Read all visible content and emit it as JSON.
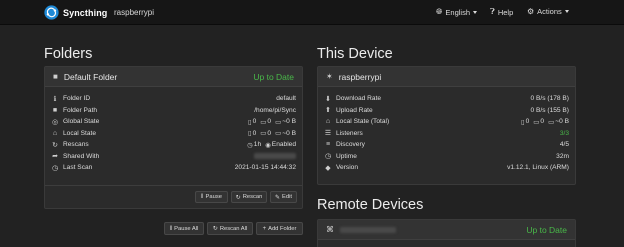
{
  "navbar": {
    "brand": "Syncthing",
    "device": "raspberrypi",
    "language": "English",
    "help": "Help",
    "actions": "Actions"
  },
  "folders": {
    "title": "Folders",
    "folder": {
      "name": "Default Folder",
      "status": "Up to Date",
      "rows": [
        {
          "icon": "info-icon",
          "label": "Folder ID",
          "value": "default"
        },
        {
          "icon": "folder-icon",
          "label": "Folder Path",
          "value": "/home/pi/Sync"
        },
        {
          "icon": "globe-icon",
          "label": "Global State",
          "files": "0",
          "dirs": "0",
          "size": "~0 B"
        },
        {
          "icon": "home-icon",
          "label": "Local State",
          "files": "0",
          "dirs": "0",
          "size": "~0 B"
        },
        {
          "icon": "refresh-icon",
          "label": "Rescans",
          "interval": "1h",
          "watch": "Enabled"
        },
        {
          "icon": "share-icon",
          "label": "Shared With",
          "value": ""
        },
        {
          "icon": "clock-icon",
          "label": "Last Scan",
          "value": "2021-01-15 14:44:32"
        }
      ],
      "buttons": {
        "pause": "Pause",
        "rescan": "Rescan",
        "edit": "Edit"
      }
    },
    "actions": {
      "pause_all": "Pause All",
      "rescan_all": "Rescan All",
      "add_folder": "Add Folder"
    }
  },
  "this_device": {
    "title": "This Device",
    "name": "raspberrypi",
    "rows": [
      {
        "icon": "download-icon",
        "label": "Download Rate",
        "value": "0 B/s (178 B)"
      },
      {
        "icon": "upload-icon",
        "label": "Upload Rate",
        "value": "0 B/s (155 B)"
      },
      {
        "icon": "home-icon",
        "label": "Local State (Total)",
        "files": "0",
        "dirs": "0",
        "size": "~0 B"
      },
      {
        "icon": "listeners-icon",
        "label": "Listeners",
        "value": "3/3"
      },
      {
        "icon": "discovery-icon",
        "label": "Discovery",
        "value": "4/5"
      },
      {
        "icon": "clock-icon",
        "label": "Uptime",
        "value": "32m"
      },
      {
        "icon": "tag-icon",
        "label": "Version",
        "value": "v1.12.1, Linux (ARM)"
      }
    ]
  },
  "remote_devices": {
    "title": "Remote Devices",
    "device": {
      "name": "",
      "status": "Up to Date"
    }
  },
  "colors": {
    "background": "#222222",
    "navbar": "#161616",
    "panel": "#2b2b2b",
    "accent_green": "#49b849",
    "logo_blue": "#1f8ad7"
  }
}
